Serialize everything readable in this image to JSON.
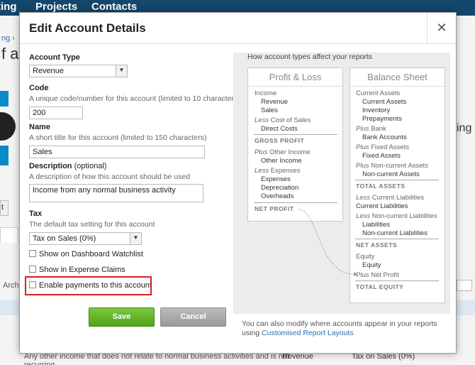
{
  "nav": {
    "items": [
      "ting",
      "Projects",
      "Contacts"
    ]
  },
  "background": {
    "breadcrumb": "ng ›",
    "title": "f acc",
    "right_word": "ing",
    "btn_text": "t",
    "archive_text": "Arch",
    "row_text_1": "Any other income that does not relate to normal business activities and is not",
    "row_text_2": "recurring",
    "row_type": "Revenue",
    "row_tax": "Tax on Sales (0%)"
  },
  "modal": {
    "title": "Edit Account Details",
    "close_icon": "close-icon",
    "account_type": {
      "label": "Account Type",
      "value": "Revenue"
    },
    "code": {
      "label": "Code",
      "hint": "A unique code/number for this account (limited to 10 characters)",
      "value": "200"
    },
    "name": {
      "label": "Name",
      "hint": "A short title for this account (limited to 150 characters)",
      "value": "Sales"
    },
    "description": {
      "label": "Description",
      "optional": "(optional)",
      "hint": "A description of how this account should be used",
      "value": "Income from any normal business activity"
    },
    "tax": {
      "label": "Tax",
      "hint": "The default tax setting for this account",
      "value": "Tax on Sales (0%)"
    },
    "checkboxes": [
      {
        "label": "Show on Dashboard Watchlist",
        "checked": false
      },
      {
        "label": "Show in Expense Claims",
        "checked": false
      },
      {
        "label": "Enable payments to this account",
        "checked": false
      }
    ],
    "save_label": "Save",
    "cancel_label": "Cancel",
    "highlight_color": "#d81f1f"
  },
  "panel": {
    "title": "How account types affect your reports",
    "pl": {
      "title": "Profit & Loss",
      "income": "Income",
      "revenue": "Revenue",
      "sales": "Sales",
      "less_cos_a": "Less",
      "less_cos_b": "Cost of Sales",
      "direct_costs": "Direct Costs",
      "gross_profit": "GROSS PROFIT",
      "plus_oi_a": "Plus",
      "plus_oi_b": "Other Income",
      "other_income": "Other Income",
      "less_exp_a": "Less",
      "less_exp_b": "Expenses",
      "expenses": "Expenses",
      "depreciation": "Depreciation",
      "overheads": "Overheads",
      "net_profit": "NET PROFIT"
    },
    "bs": {
      "title": "Balance Sheet",
      "current_assets_h": "Current Assets",
      "current_assets": "Current Assets",
      "inventory": "Inventory",
      "prepayments": "Prepayments",
      "plus_bank_a": "Plus",
      "plus_bank_b": "Bank",
      "bank_accounts": "Bank Accounts",
      "plus_fa_a": "Plus",
      "plus_fa_b": "Fixed Assets",
      "fixed_assets": "Fixed Assets",
      "plus_nca_a": "Plus",
      "plus_nca_b": "Non-current Assets",
      "non_current_assets": "Non-current Assets",
      "total_assets": "TOTAL ASSETS",
      "less_cl_a": "Less",
      "less_cl_b": "Current Liabilities",
      "current_liabilities": "Current Liabilities",
      "less_ncl_a": "Less",
      "less_ncl_b": "Non-current Liabilities",
      "liabilities": "Liabilities",
      "non_current_liabilities": "Non-current Liabilities",
      "net_assets": "NET ASSETS",
      "equity_h": "Equity",
      "equity": "Equity",
      "plus_np_a": "Plus",
      "plus_np_b": "Net Profit",
      "total_equity": "TOTAL EQUITY"
    },
    "footer_1": "You can also modify where accounts appear in your reports",
    "footer_2_pre": "using ",
    "footer_link": "Customised Report Layouts"
  }
}
